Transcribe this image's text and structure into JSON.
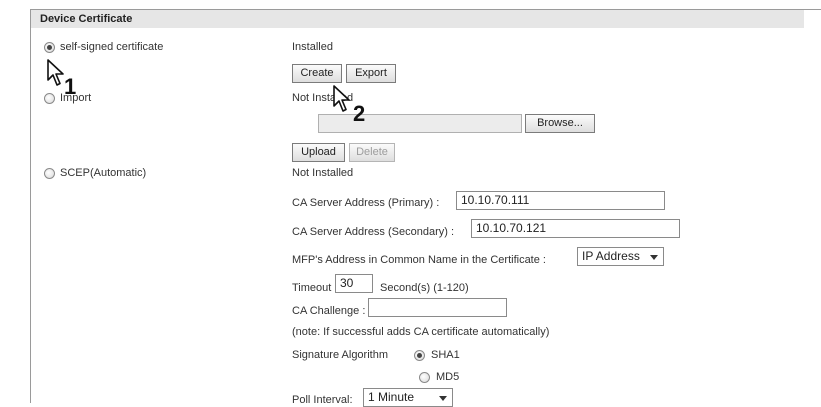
{
  "section": {
    "title": "Device Certificate"
  },
  "options": {
    "self_signed": {
      "label": "self-signed certificate",
      "checked": true,
      "status": "Installed"
    },
    "import": {
      "label": "Import",
      "checked": false,
      "status": "Not Installed"
    },
    "scep": {
      "label": "SCEP(Automatic)",
      "checked": false,
      "status": "Not Installed"
    }
  },
  "buttons": {
    "create": "Create",
    "export": "Export",
    "browse": "Browse...",
    "upload": "Upload",
    "delete": "Delete"
  },
  "scep_fields": {
    "ca_primary_label": "CA Server Address (Primary) :",
    "ca_primary_value": "10.10.70.111",
    "ca_secondary_label": "CA Server Address (Secondary) :",
    "ca_secondary_value": "10.10.70.121",
    "mfp_label": "MFP's Address in Common Name in the Certificate :",
    "mfp_value": "IP Address",
    "timeout_label": "Timeout :",
    "timeout_value": "30",
    "timeout_unit": "Second(s) (1-120)",
    "challenge_label": "CA Challenge :",
    "challenge_value": "",
    "note": "(note: If successful adds CA certificate automatically)",
    "sig_label": "Signature Algorithm",
    "sig_sha1": "SHA1",
    "sig_md5": "MD5",
    "poll_label": "Poll Interval:",
    "poll_value": "1 Minute"
  },
  "callouts": {
    "first": "1",
    "second": "2"
  },
  "icons": {
    "cursor": "hand-pointer-cursor-icon"
  }
}
